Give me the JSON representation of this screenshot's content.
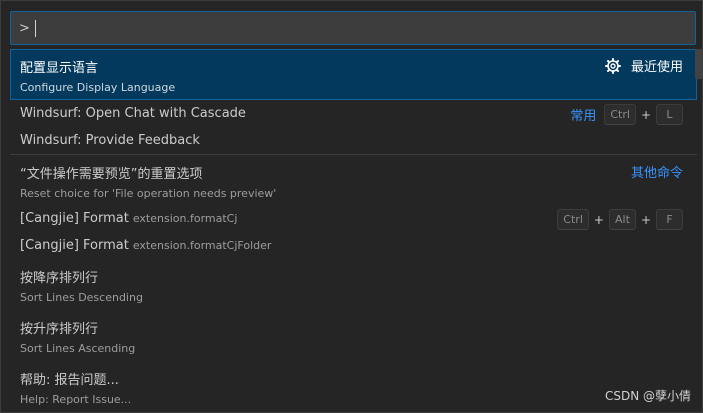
{
  "input": {
    "value": ">",
    "placeholder": ""
  },
  "items": [
    {
      "label": "配置显示语言",
      "description": "Configure Display Language",
      "icon": "gear-icon",
      "tag": "最近使用"
    },
    {
      "label": "Windsurf: Open Chat with Cascade",
      "tag": "常用",
      "keys": [
        "Ctrl",
        "L"
      ]
    },
    {
      "label": "Windsurf: Provide Feedback"
    },
    {
      "label": "“文件操作需要预览”的重置选项",
      "description": "Reset choice for 'File operation needs preview'",
      "tag": "其他命令"
    },
    {
      "label": "[Cangjie] Format",
      "command_id": "extension.formatCj",
      "keys": [
        "Ctrl",
        "Alt",
        "F"
      ]
    },
    {
      "label": "[Cangjie] Format",
      "command_id": "extension.formatCjFolder"
    },
    {
      "label": "按降序排列行",
      "description": "Sort Lines Descending"
    },
    {
      "label": "按升序排列行",
      "description": "Sort Lines Ascending"
    },
    {
      "label": "帮助: 报告问题...",
      "description": "Help: Report Issue..."
    }
  ],
  "plus_sign": "+",
  "watermark": "CSDN @孽小倩",
  "colors": {
    "accent": "#0e639c",
    "selection": "#04395e",
    "link": "#3794ff"
  }
}
